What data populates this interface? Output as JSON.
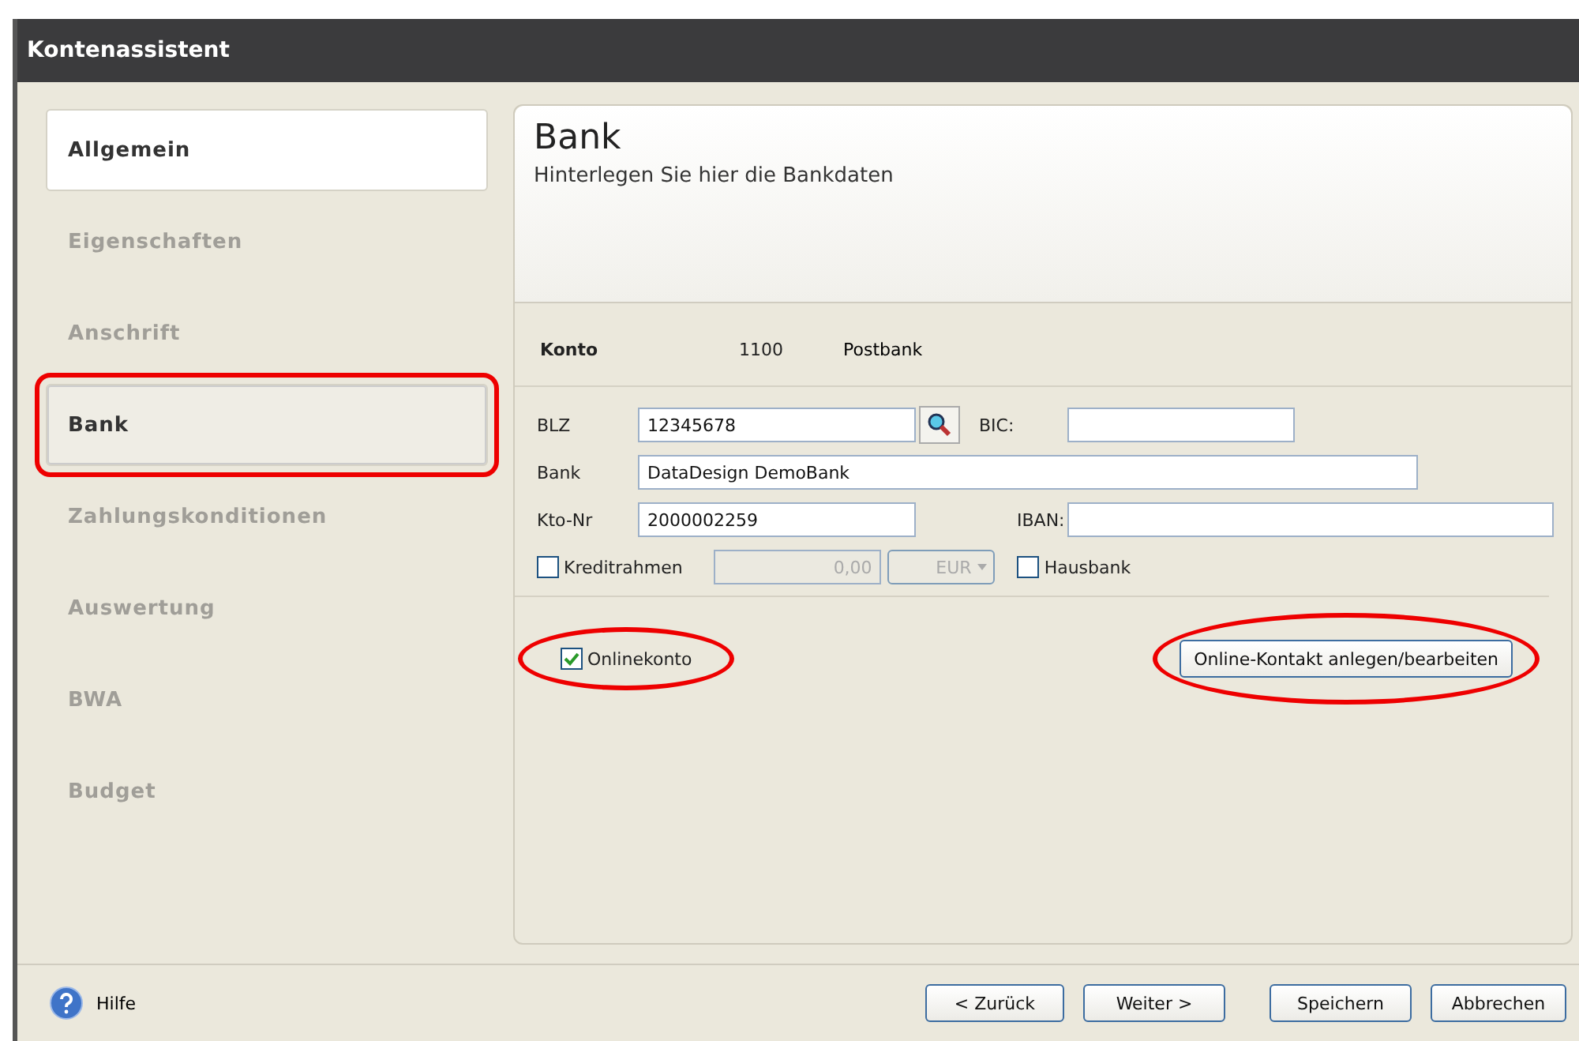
{
  "window": {
    "title": "Kontenassistent"
  },
  "sidebar": {
    "items": [
      {
        "label": "Allgemein",
        "selected": false,
        "visited": true,
        "highlighted": false
      },
      {
        "label": "Eigenschaften",
        "selected": false,
        "visited": false,
        "highlighted": false
      },
      {
        "label": "Anschrift",
        "selected": false,
        "visited": false,
        "highlighted": false
      },
      {
        "label": "Bank",
        "selected": true,
        "visited": true,
        "highlighted": true
      },
      {
        "label": "Zahlungskonditionen",
        "selected": false,
        "visited": false,
        "highlighted": false
      },
      {
        "label": "Auswertung",
        "selected": false,
        "visited": false,
        "highlighted": false
      },
      {
        "label": "BWA",
        "selected": false,
        "visited": false,
        "highlighted": false
      },
      {
        "label": "Budget",
        "selected": false,
        "visited": false,
        "highlighted": false
      }
    ]
  },
  "header": {
    "title": "Bank",
    "subtitle": "Hinterlegen Sie hier die Bankdaten"
  },
  "account": {
    "label": "Konto",
    "number": "1100",
    "name": "Postbank"
  },
  "form": {
    "blz": {
      "label": "BLZ",
      "value": "12345678"
    },
    "bic": {
      "label": "BIC:"
    },
    "bank": {
      "label": "Bank",
      "value": "DataDesign DemoBank"
    },
    "kto": {
      "label": "Kto-Nr",
      "value": "2000002259"
    },
    "iban": {
      "label": "IBAN:"
    },
    "kreditrahmen": {
      "label": "Kreditrahmen",
      "checked": false,
      "value": "0,00",
      "currency": "EUR",
      "disabled": true
    },
    "hausbank": {
      "label": "Hausbank",
      "checked": false
    },
    "onlinekonto": {
      "label": "Onlinekonto",
      "checked": true,
      "highlighted": true
    },
    "online_button": {
      "label": "Online-Kontakt anlegen/bearbeiten",
      "highlighted": true
    }
  },
  "footer": {
    "help": "Hilfe",
    "buttons": [
      "< Zurück",
      "Weiter >",
      "Speichern",
      "Abbrechen"
    ]
  }
}
